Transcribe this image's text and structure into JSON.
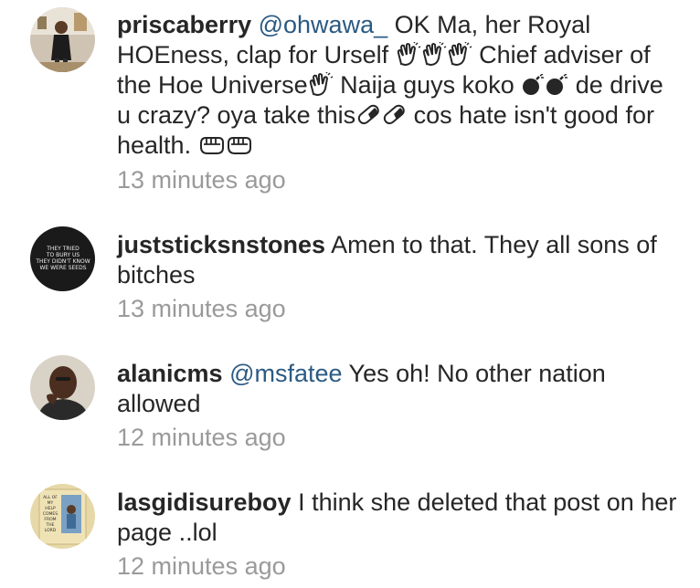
{
  "comments": [
    {
      "username": "priscaberry",
      "mention": "@ohwawa_",
      "segments": [
        " OK Ma, her Royal HOEness, clap for Urself ",
        " Chief adviser of the Hoe Universe",
        "  Naija guys koko ",
        " de drive u crazy? oya take this",
        " cos hate isn't good for health. "
      ],
      "time": "13 minutes ago",
      "avatar_icon": "profile-photo"
    },
    {
      "username": "juststicksnstones",
      "mention": "",
      "body": " Amen to that. They all sons of bitches",
      "time": "13 minutes ago",
      "avatar_icon": "text-quote-avatar",
      "avatar_text": [
        "THEY TRIED",
        "TO BURY US",
        "THEY DIDN'T KNOW",
        "WE WERE SEEDS"
      ]
    },
    {
      "username": "alanicms",
      "mention": "@msfatee",
      "body": " Yes oh! No other nation allowed",
      "time": "12 minutes ago",
      "avatar_icon": "profile-photo"
    },
    {
      "username": "lasgidisureboy",
      "mention": "",
      "body": " I think she deleted that post on her page ..lol",
      "time": "12 minutes ago",
      "avatar_icon": "book-cover-avatar",
      "avatar_text": [
        "ALL OF",
        "MY",
        "HELP",
        "COMES",
        "FROM",
        "THE",
        "LORD"
      ]
    }
  ],
  "emoji": {
    "clap": "clapping-hands-icon",
    "bomb": "bomb-icon",
    "pill": "pill-icon",
    "fist": "fist-icon"
  },
  "colors": {
    "text": "#262626",
    "mention": "#2b5a83",
    "timestamp": "#9a9a9a"
  }
}
